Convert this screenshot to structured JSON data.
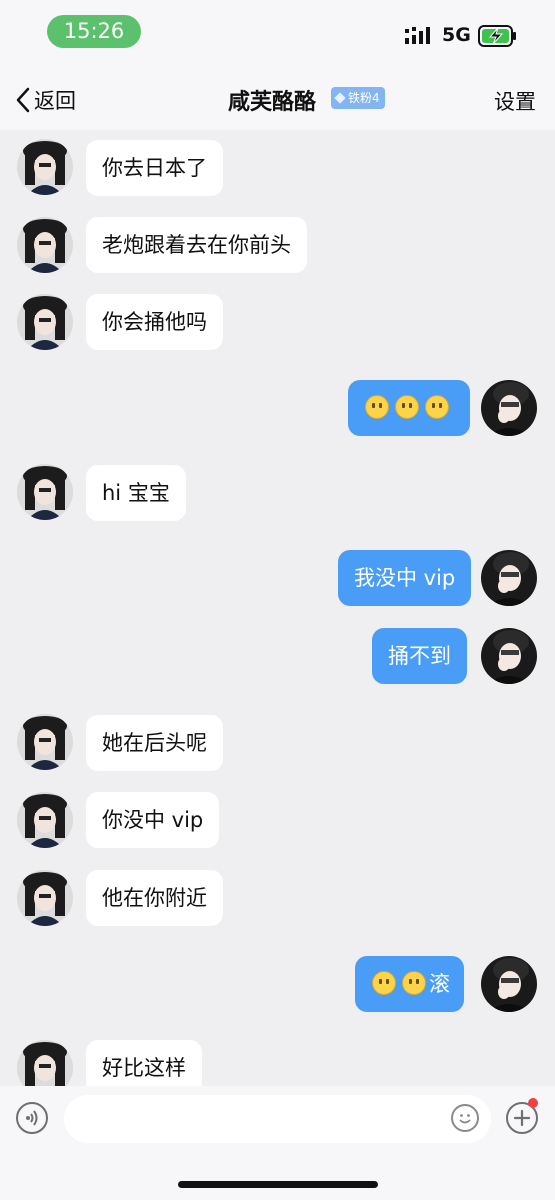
{
  "status_bar": {
    "time": "15:26",
    "network": "5G",
    "icons": [
      "signal-icon",
      "battery-charging-icon"
    ]
  },
  "nav": {
    "back_label": "返回",
    "title": "咸芙酪酪",
    "badge": "铁粉4",
    "settings_label": "设置"
  },
  "colors": {
    "outgoing_bubble": "#4a9df6",
    "incoming_bubble": "#ffffff",
    "time_pill": "#5cc16c",
    "badge": "#82b5f2"
  },
  "messages": [
    {
      "side": "in",
      "text": "你去日本了"
    },
    {
      "side": "in",
      "text": "老炮跟着去在你前头"
    },
    {
      "side": "in",
      "text": "你会捅他吗"
    },
    {
      "side": "out",
      "text": "",
      "emojis": 3
    },
    {
      "side": "in",
      "text": "hi 宝宝"
    },
    {
      "side": "out",
      "text": "我没中 vip"
    },
    {
      "side": "out",
      "text": "捅不到"
    },
    {
      "side": "in",
      "text": "她在后头呢"
    },
    {
      "side": "in",
      "text": "你没中 vip"
    },
    {
      "side": "in",
      "text": "他在你附近"
    },
    {
      "side": "out",
      "text": "滚",
      "emojis": 2
    },
    {
      "side": "in",
      "text": "好比这样"
    }
  ],
  "input": {
    "placeholder": "",
    "icons": [
      "voice-icon",
      "emoji-icon",
      "plus-icon"
    ]
  }
}
